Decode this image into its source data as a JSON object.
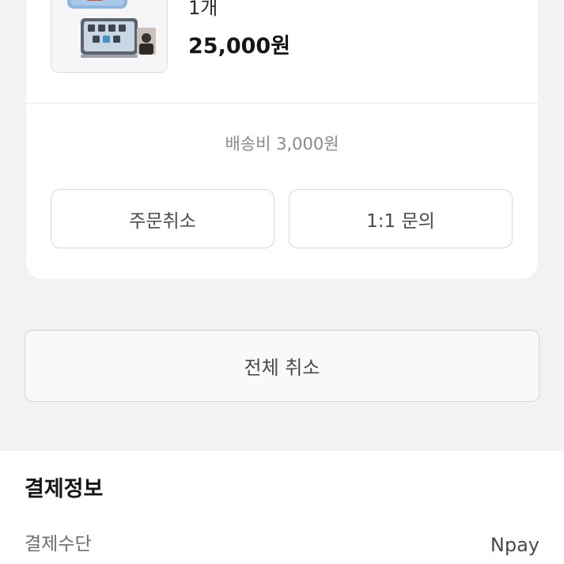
{
  "order_item": {
    "quantity": "1개",
    "price": "25,000원",
    "thumbnail_icon": "product-thumbnail-image"
  },
  "shipping": {
    "fee_text": "배송비 3,000원"
  },
  "actions": {
    "cancel_order_label": "주문취소",
    "inquiry_label": "1:1 문의"
  },
  "cancel_all": {
    "label": "전체 취소"
  },
  "payment_info": {
    "title": "결제정보",
    "method_label": "결제수단",
    "method_value": "Npay"
  },
  "colors": {
    "background": "#f2f2f4",
    "card": "#ffffff",
    "border": "#d6d6d9",
    "muted_text": "#8a8a8e"
  }
}
